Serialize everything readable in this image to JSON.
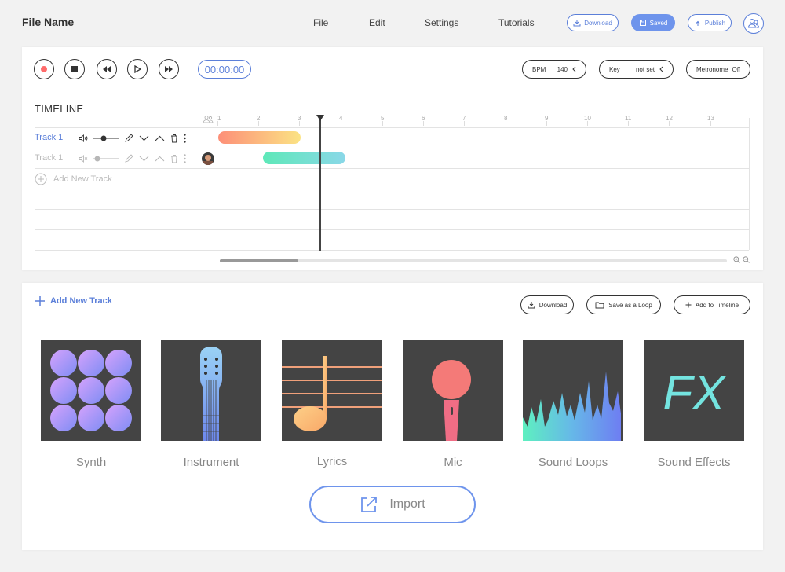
{
  "header": {
    "file_name": "File Name",
    "menu": [
      "File",
      "Edit",
      "Settings",
      "Tutorials"
    ],
    "download_label": "Download",
    "saved_label": "Saved",
    "publish_label": "Publish"
  },
  "transport": {
    "time": "00:00:00",
    "bpm_label": "BPM",
    "bpm_value": "140",
    "key_label": "Key",
    "key_value": "not set",
    "metronome_label": "Metronome",
    "metronome_value": "Off"
  },
  "timeline": {
    "title": "TIMELINE",
    "ruler": [
      "1",
      "2",
      "3",
      "4",
      "5",
      "6",
      "7",
      "8",
      "9",
      "10",
      "11",
      "12",
      "13"
    ],
    "tracks": [
      {
        "name": "Track 1",
        "active": true
      },
      {
        "name": "Track 1",
        "active": false
      }
    ],
    "add_track_label": "Add New Track"
  },
  "library": {
    "add_new_track": "Add New Track",
    "download_label": "Download",
    "save_loop_label": "Save as a Loop",
    "add_timeline_label": "Add to Timeline",
    "tiles": [
      "Synth",
      "Instrument",
      "Lyrics",
      "Mic",
      "Sound Loops",
      "Sound Effects"
    ],
    "fx_text": "FX",
    "import_label": "Import"
  },
  "colors": {
    "accent": "#5b7fd9",
    "tile_bg": "#444444"
  }
}
